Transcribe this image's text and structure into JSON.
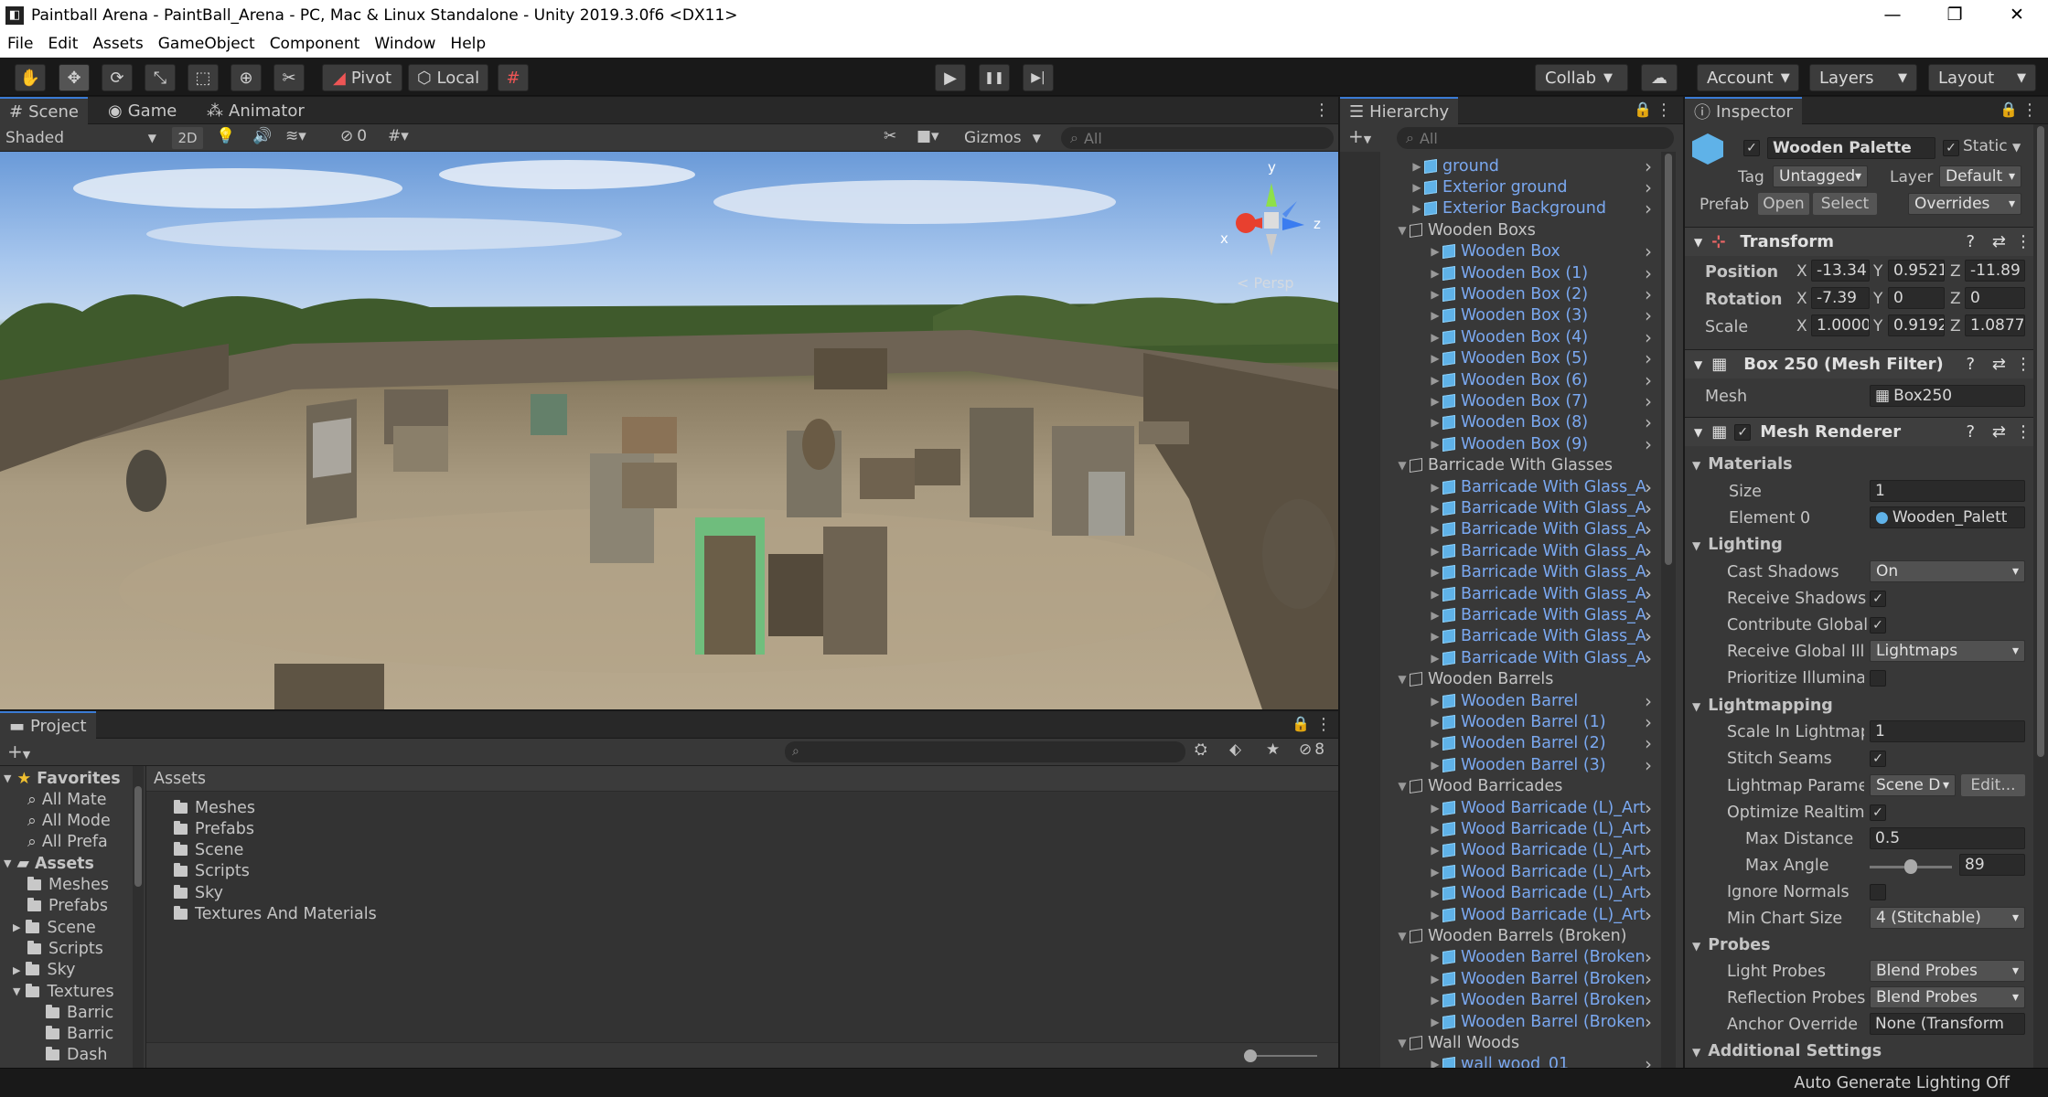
{
  "window": {
    "title": "Paintball Arena - PaintBall_Arena - PC, Mac & Linux Standalone - Unity 2019.3.0f6 <DX11>",
    "logo_glyph": "◧",
    "minimize_glyph": "—",
    "maximize_glyph": "❐",
    "close_glyph": "✕"
  },
  "menu": [
    "File",
    "Edit",
    "Assets",
    "GameObject",
    "Component",
    "Window",
    "Help"
  ],
  "toolbar": {
    "pivot": "Pivot",
    "local": "Local",
    "collab": "Collab",
    "account": "Account",
    "layers": "Layers",
    "layout": "Layout",
    "hand_glyph": "✋",
    "move_glyph": "✥",
    "rotate_glyph": "⟳",
    "scale_glyph": "⤡",
    "rect_glyph": "⬚",
    "transform_glyph": "⊕",
    "custom_glyph": "✂",
    "snap_glyph": "#",
    "play_glyph": "▶",
    "pause_glyph": "❚❚",
    "step_glyph": "▶|",
    "cloud_glyph": "☁",
    "pivot_icon_glyph": "◢",
    "local_icon_glyph": "⬡"
  },
  "scene": {
    "tabs": [
      "Scene",
      "Game",
      "Animator"
    ],
    "shading": "Shaded",
    "mode_2d": "2D",
    "gizmos": "Gizmos",
    "search_placeholder": "All",
    "hidden_count": "0",
    "persp_label": "< Persp",
    "axis_x": "x",
    "axis_y": "y",
    "axis_z": "z"
  },
  "hierarchy": {
    "tab": "Hierarchy",
    "search_placeholder": "All",
    "rows": [
      {
        "label": "ground",
        "type": "prefab",
        "indent": 1
      },
      {
        "label": "Exterior ground",
        "type": "prefab",
        "indent": 1
      },
      {
        "label": "Exterior Background",
        "type": "prefab",
        "indent": 1
      },
      {
        "label": "Wooden Boxs",
        "type": "group",
        "indent": 0
      },
      {
        "label": "Wooden Box",
        "type": "prefab",
        "indent": 2
      },
      {
        "label": "Wooden Box (1)",
        "type": "prefab",
        "indent": 2
      },
      {
        "label": "Wooden Box (2)",
        "type": "prefab",
        "indent": 2
      },
      {
        "label": "Wooden Box (3)",
        "type": "prefab",
        "indent": 2
      },
      {
        "label": "Wooden Box (4)",
        "type": "prefab",
        "indent": 2
      },
      {
        "label": "Wooden Box (5)",
        "type": "prefab",
        "indent": 2
      },
      {
        "label": "Wooden Box (6)",
        "type": "prefab",
        "indent": 2
      },
      {
        "label": "Wooden Box (7)",
        "type": "prefab",
        "indent": 2
      },
      {
        "label": "Wooden Box (8)",
        "type": "prefab",
        "indent": 2
      },
      {
        "label": "Wooden Box (9)",
        "type": "prefab",
        "indent": 2
      },
      {
        "label": "Barricade With Glasses",
        "type": "group",
        "indent": 0
      },
      {
        "label": "Barricade With Glass_A",
        "type": "prefab",
        "indent": 2
      },
      {
        "label": "Barricade With Glass_A",
        "type": "prefab",
        "indent": 2
      },
      {
        "label": "Barricade With Glass_A",
        "type": "prefab",
        "indent": 2
      },
      {
        "label": "Barricade With Glass_A",
        "type": "prefab",
        "indent": 2
      },
      {
        "label": "Barricade With Glass_A",
        "type": "prefab",
        "indent": 2
      },
      {
        "label": "Barricade With Glass_A",
        "type": "prefab",
        "indent": 2
      },
      {
        "label": "Barricade With Glass_A",
        "type": "prefab",
        "indent": 2
      },
      {
        "label": "Barricade With Glass_A",
        "type": "prefab",
        "indent": 2
      },
      {
        "label": "Barricade With Glass_A",
        "type": "prefab",
        "indent": 2
      },
      {
        "label": "Wooden Barrels",
        "type": "group",
        "indent": 0
      },
      {
        "label": "Wooden Barrel",
        "type": "prefab",
        "indent": 2
      },
      {
        "label": "Wooden Barrel (1)",
        "type": "prefab",
        "indent": 2
      },
      {
        "label": "Wooden Barrel (2)",
        "type": "prefab",
        "indent": 2
      },
      {
        "label": "Wooden Barrel (3)",
        "type": "prefab",
        "indent": 2
      },
      {
        "label": "Wood Barricades",
        "type": "group",
        "indent": 0
      },
      {
        "label": "Wood Barricade (L)_Art",
        "type": "prefab",
        "indent": 2
      },
      {
        "label": "Wood Barricade (L)_Art",
        "type": "prefab",
        "indent": 2
      },
      {
        "label": "Wood Barricade (L)_Art",
        "type": "prefab",
        "indent": 2
      },
      {
        "label": "Wood Barricade (L)_Art",
        "type": "prefab",
        "indent": 2
      },
      {
        "label": "Wood Barricade (L)_Art",
        "type": "prefab",
        "indent": 2
      },
      {
        "label": "Wood Barricade (L)_Art",
        "type": "prefab",
        "indent": 2
      },
      {
        "label": "Wooden Barrels (Broken)",
        "type": "group",
        "indent": 0
      },
      {
        "label": "Wooden Barrel (Broken",
        "type": "prefab",
        "indent": 2
      },
      {
        "label": "Wooden Barrel (Broken",
        "type": "prefab",
        "indent": 2
      },
      {
        "label": "Wooden Barrel (Broken",
        "type": "prefab",
        "indent": 2
      },
      {
        "label": "Wooden Barrel (Broken",
        "type": "prefab",
        "indent": 2
      },
      {
        "label": "Wall Woods",
        "type": "group",
        "indent": 0
      },
      {
        "label": "wall wood_01",
        "type": "prefab",
        "indent": 2
      }
    ]
  },
  "inspector": {
    "tab": "Inspector",
    "name": "Wooden Palette",
    "static": "Static",
    "tag_label": "Tag",
    "tag": "Untagged",
    "layer_label": "Layer",
    "layer": "Default",
    "prefab_label": "Prefab",
    "open": "Open",
    "select": "Select",
    "overrides": "Overrides",
    "transform": {
      "title": "Transform",
      "position_label": "Position",
      "rotation_label": "Rotation",
      "scale_label": "Scale",
      "pos": [
        "-13.34",
        "0.9521",
        "-11.89"
      ],
      "rot": [
        "-7.39",
        "0",
        "0"
      ],
      "scale": [
        "1.0000",
        "0.9192",
        "1.0877"
      ],
      "x": "X",
      "y": "Y",
      "z": "Z"
    },
    "mesh_filter": {
      "title": "Box 250 (Mesh Filter)",
      "mesh_label": "Mesh",
      "mesh": "Box250"
    },
    "mesh_renderer": {
      "title": "Mesh Renderer",
      "materials": "Materials",
      "size_label": "Size",
      "size": "1",
      "element0_label": "Element 0",
      "element0": "Wooden_Palett",
      "lighting": "Lighting",
      "cast_shadows_label": "Cast Shadows",
      "cast_shadows": "On",
      "receive_shadows_label": "Receive Shadows",
      "contribute_gi_label": "Contribute Global",
      "receive_gi_label": "Receive Global Illu",
      "receive_gi": "Lightmaps",
      "prioritize_label": "Prioritize Illuminat",
      "lightmapping": "Lightmapping",
      "scale_lightmap_label": "Scale In Lightmap",
      "scale_lightmap": "1",
      "stitch_label": "Stitch Seams",
      "lm_params_label": "Lightmap Paramet",
      "lm_params": "Scene D",
      "edit": "Edit...",
      "optimize_label": "Optimize Realtime",
      "max_distance_label": "Max Distance",
      "max_distance": "0.5",
      "max_angle_label": "Max Angle",
      "max_angle": "89",
      "max_angle_fraction": 0.5,
      "ignore_normals_label": "Ignore Normals",
      "min_chart_label": "Min Chart Size",
      "min_chart": "4 (Stitchable)",
      "probes": "Probes",
      "light_probes_label": "Light Probes",
      "light_probes": "Blend Probes",
      "refl_probes_label": "Reflection Probes",
      "refl_probes": "Blend Probes",
      "anchor_label": "Anchor Override",
      "anchor": "None (Transform",
      "additional": "Additional Settings"
    }
  },
  "project": {
    "tab": "Project",
    "breadcrumb": "Assets",
    "hidden_count": "8",
    "tree": [
      {
        "label": "Favorites",
        "kind": "header",
        "indent": 0
      },
      {
        "label": "All Mate",
        "kind": "search",
        "indent": 1
      },
      {
        "label": "All Mode",
        "kind": "search",
        "indent": 1
      },
      {
        "label": "All Prefa",
        "kind": "search",
        "indent": 1
      },
      {
        "label": "Assets",
        "kind": "header",
        "indent": 0
      },
      {
        "label": "Meshes",
        "kind": "folder",
        "indent": 1
      },
      {
        "label": "Prefabs",
        "kind": "folder",
        "indent": 1
      },
      {
        "label": "Scene",
        "kind": "folder",
        "indent": 1
      },
      {
        "label": "Scripts",
        "kind": "folder",
        "indent": 1
      },
      {
        "label": "Sky",
        "kind": "folder",
        "indent": 1
      },
      {
        "label": "Textures",
        "kind": "folder",
        "indent": 1
      },
      {
        "label": "Barric",
        "kind": "folder",
        "indent": 2
      },
      {
        "label": "Barric",
        "kind": "folder",
        "indent": 2
      },
      {
        "label": "Dash",
        "kind": "folder",
        "indent": 2
      }
    ],
    "folders": [
      "Meshes",
      "Prefabs",
      "Scene",
      "Scripts",
      "Sky",
      "Textures And Materials"
    ]
  },
  "status": {
    "text": "Auto Generate Lighting Off"
  }
}
